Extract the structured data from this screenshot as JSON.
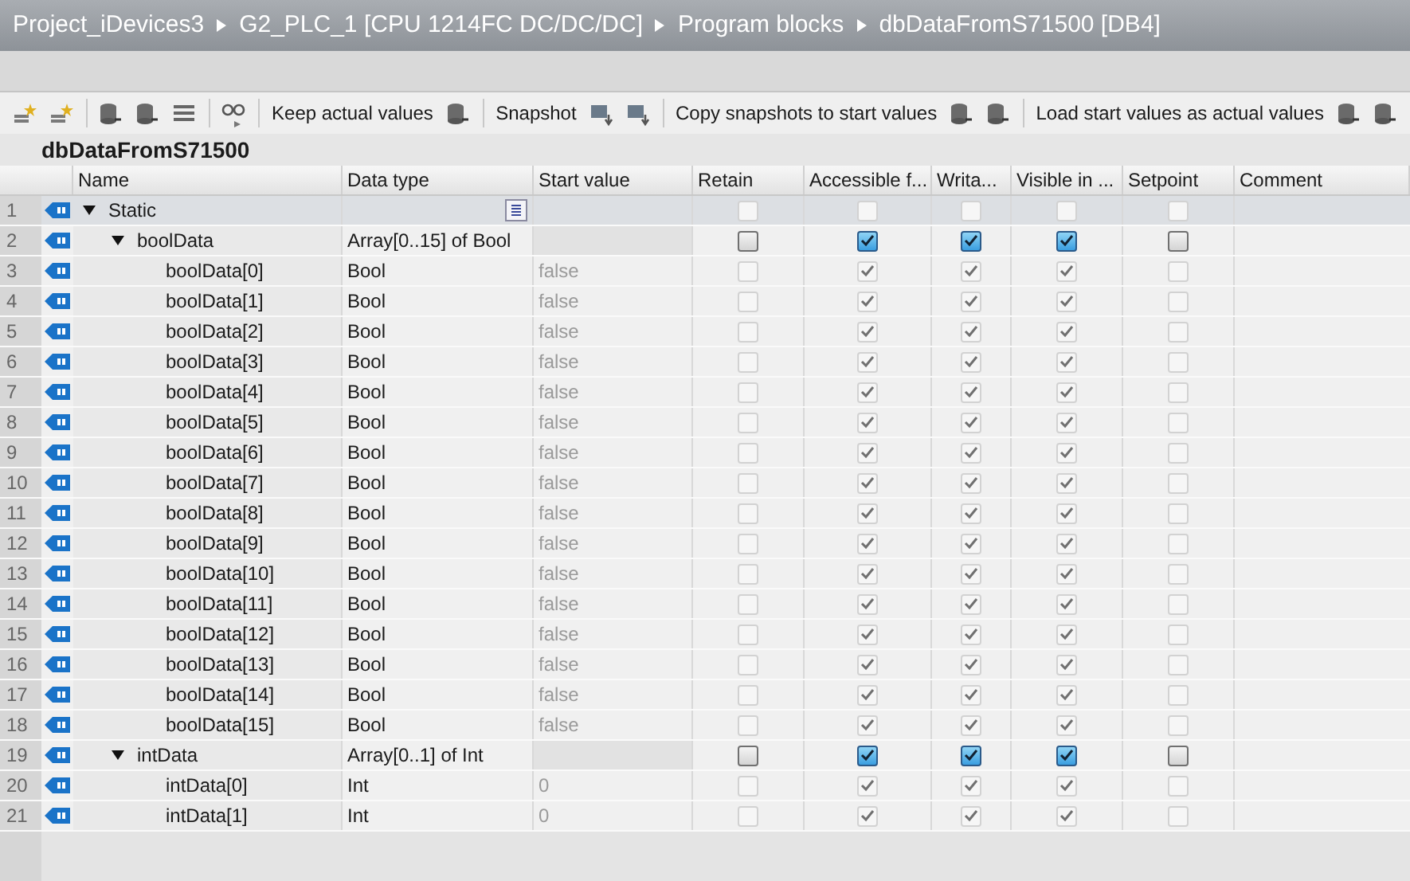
{
  "breadcrumb": [
    "Project_iDevices3",
    "G2_PLC_1 [CPU 1214FC DC/DC/DC]",
    "Program blocks",
    "dbDataFromS71500 [DB4]"
  ],
  "toolbar": [
    "Keep actual values",
    "Snapshot",
    "Copy snapshots to start values",
    "Load start values as actual values"
  ],
  "block_title": "dbDataFromS71500",
  "columns": [
    "Name",
    "Data type",
    "Start value",
    "Retain",
    "Accessible f...",
    "Writa...",
    "Visible in ...",
    "Setpoint",
    "Comment"
  ],
  "rows": [
    {
      "number": "1",
      "name": "Static",
      "expanded": true,
      "flags": [
        {
          "checked": false,
          "disabled": true
        },
        {
          "checked": false,
          "disabled": true
        },
        {
          "checked": false,
          "disabled": true
        },
        {
          "checked": false,
          "disabled": true
        },
        {
          "checked": false,
          "disabled": true
        }
      ],
      "children": [
        {
          "number": "2",
          "name": "boolData",
          "data_type": "Array[0..15] of Bool",
          "expanded": true,
          "flags": [
            {
              "checked": false,
              "disabled": false
            },
            {
              "checked": true,
              "disabled": false
            },
            {
              "checked": true,
              "disabled": false
            },
            {
              "checked": true,
              "disabled": false
            },
            {
              "checked": false,
              "disabled": false
            }
          ],
          "children": [
            {
              "number": "3",
              "name": "boolData[0]",
              "data_type": "Bool",
              "start_value": "false",
              "flags": [
                {
                  "checked": false,
                  "disabled": true
                },
                {
                  "checked": true,
                  "disabled": true
                },
                {
                  "checked": true,
                  "disabled": true
                },
                {
                  "checked": true,
                  "disabled": true
                },
                {
                  "checked": false,
                  "disabled": true
                }
              ]
            },
            {
              "number": "4",
              "name": "boolData[1]",
              "data_type": "Bool",
              "start_value": "false",
              "flags": [
                {
                  "checked": false,
                  "disabled": true
                },
                {
                  "checked": true,
                  "disabled": true
                },
                {
                  "checked": true,
                  "disabled": true
                },
                {
                  "checked": true,
                  "disabled": true
                },
                {
                  "checked": false,
                  "disabled": true
                }
              ]
            },
            {
              "number": "5",
              "name": "boolData[2]",
              "data_type": "Bool",
              "start_value": "false",
              "flags": [
                {
                  "checked": false,
                  "disabled": true
                },
                {
                  "checked": true,
                  "disabled": true
                },
                {
                  "checked": true,
                  "disabled": true
                },
                {
                  "checked": true,
                  "disabled": true
                },
                {
                  "checked": false,
                  "disabled": true
                }
              ]
            },
            {
              "number": "6",
              "name": "boolData[3]",
              "data_type": "Bool",
              "start_value": "false",
              "flags": [
                {
                  "checked": false,
                  "disabled": true
                },
                {
                  "checked": true,
                  "disabled": true
                },
                {
                  "checked": true,
                  "disabled": true
                },
                {
                  "checked": true,
                  "disabled": true
                },
                {
                  "checked": false,
                  "disabled": true
                }
              ]
            },
            {
              "number": "7",
              "name": "boolData[4]",
              "data_type": "Bool",
              "start_value": "false",
              "flags": [
                {
                  "checked": false,
                  "disabled": true
                },
                {
                  "checked": true,
                  "disabled": true
                },
                {
                  "checked": true,
                  "disabled": true
                },
                {
                  "checked": true,
                  "disabled": true
                },
                {
                  "checked": false,
                  "disabled": true
                }
              ]
            },
            {
              "number": "8",
              "name": "boolData[5]",
              "data_type": "Bool",
              "start_value": "false",
              "flags": [
                {
                  "checked": false,
                  "disabled": true
                },
                {
                  "checked": true,
                  "disabled": true
                },
                {
                  "checked": true,
                  "disabled": true
                },
                {
                  "checked": true,
                  "disabled": true
                },
                {
                  "checked": false,
                  "disabled": true
                }
              ]
            },
            {
              "number": "9",
              "name": "boolData[6]",
              "data_type": "Bool",
              "start_value": "false",
              "flags": [
                {
                  "checked": false,
                  "disabled": true
                },
                {
                  "checked": true,
                  "disabled": true
                },
                {
                  "checked": true,
                  "disabled": true
                },
                {
                  "checked": true,
                  "disabled": true
                },
                {
                  "checked": false,
                  "disabled": true
                }
              ]
            },
            {
              "number": "10",
              "name": "boolData[7]",
              "data_type": "Bool",
              "start_value": "false",
              "flags": [
                {
                  "checked": false,
                  "disabled": true
                },
                {
                  "checked": true,
                  "disabled": true
                },
                {
                  "checked": true,
                  "disabled": true
                },
                {
                  "checked": true,
                  "disabled": true
                },
                {
                  "checked": false,
                  "disabled": true
                }
              ]
            },
            {
              "number": "11",
              "name": "boolData[8]",
              "data_type": "Bool",
              "start_value": "false",
              "flags": [
                {
                  "checked": false,
                  "disabled": true
                },
                {
                  "checked": true,
                  "disabled": true
                },
                {
                  "checked": true,
                  "disabled": true
                },
                {
                  "checked": true,
                  "disabled": true
                },
                {
                  "checked": false,
                  "disabled": true
                }
              ]
            },
            {
              "number": "12",
              "name": "boolData[9]",
              "data_type": "Bool",
              "start_value": "false",
              "flags": [
                {
                  "checked": false,
                  "disabled": true
                },
                {
                  "checked": true,
                  "disabled": true
                },
                {
                  "checked": true,
                  "disabled": true
                },
                {
                  "checked": true,
                  "disabled": true
                },
                {
                  "checked": false,
                  "disabled": true
                }
              ]
            },
            {
              "number": "13",
              "name": "boolData[10]",
              "data_type": "Bool",
              "start_value": "false",
              "flags": [
                {
                  "checked": false,
                  "disabled": true
                },
                {
                  "checked": true,
                  "disabled": true
                },
                {
                  "checked": true,
                  "disabled": true
                },
                {
                  "checked": true,
                  "disabled": true
                },
                {
                  "checked": false,
                  "disabled": true
                }
              ]
            },
            {
              "number": "14",
              "name": "boolData[11]",
              "data_type": "Bool",
              "start_value": "false",
              "flags": [
                {
                  "checked": false,
                  "disabled": true
                },
                {
                  "checked": true,
                  "disabled": true
                },
                {
                  "checked": true,
                  "disabled": true
                },
                {
                  "checked": true,
                  "disabled": true
                },
                {
                  "checked": false,
                  "disabled": true
                }
              ]
            },
            {
              "number": "15",
              "name": "boolData[12]",
              "data_type": "Bool",
              "start_value": "false",
              "flags": [
                {
                  "checked": false,
                  "disabled": true
                },
                {
                  "checked": true,
                  "disabled": true
                },
                {
                  "checked": true,
                  "disabled": true
                },
                {
                  "checked": true,
                  "disabled": true
                },
                {
                  "checked": false,
                  "disabled": true
                }
              ]
            },
            {
              "number": "16",
              "name": "boolData[13]",
              "data_type": "Bool",
              "start_value": "false",
              "flags": [
                {
                  "checked": false,
                  "disabled": true
                },
                {
                  "checked": true,
                  "disabled": true
                },
                {
                  "checked": true,
                  "disabled": true
                },
                {
                  "checked": true,
                  "disabled": true
                },
                {
                  "checked": false,
                  "disabled": true
                }
              ]
            },
            {
              "number": "17",
              "name": "boolData[14]",
              "data_type": "Bool",
              "start_value": "false",
              "flags": [
                {
                  "checked": false,
                  "disabled": true
                },
                {
                  "checked": true,
                  "disabled": true
                },
                {
                  "checked": true,
                  "disabled": true
                },
                {
                  "checked": true,
                  "disabled": true
                },
                {
                  "checked": false,
                  "disabled": true
                }
              ]
            },
            {
              "number": "18",
              "name": "boolData[15]",
              "data_type": "Bool",
              "start_value": "false",
              "flags": [
                {
                  "checked": false,
                  "disabled": true
                },
                {
                  "checked": true,
                  "disabled": true
                },
                {
                  "checked": true,
                  "disabled": true
                },
                {
                  "checked": true,
                  "disabled": true
                },
                {
                  "checked": false,
                  "disabled": true
                }
              ]
            }
          ]
        },
        {
          "number": "19",
          "name": "intData",
          "data_type": "Array[0..1] of Int",
          "expanded": true,
          "flags": [
            {
              "checked": false,
              "disabled": false
            },
            {
              "checked": true,
              "disabled": false
            },
            {
              "checked": true,
              "disabled": false
            },
            {
              "checked": true,
              "disabled": false
            },
            {
              "checked": false,
              "disabled": false
            }
          ],
          "children": [
            {
              "number": "20",
              "name": "intData[0]",
              "data_type": "Int",
              "start_value": "0",
              "flags": [
                {
                  "checked": false,
                  "disabled": true
                },
                {
                  "checked": true,
                  "disabled": true
                },
                {
                  "checked": true,
                  "disabled": true
                },
                {
                  "checked": true,
                  "disabled": true
                },
                {
                  "checked": false,
                  "disabled": true
                }
              ]
            },
            {
              "number": "21",
              "name": "intData[1]",
              "data_type": "Int",
              "start_value": "0",
              "flags": [
                {
                  "checked": false,
                  "disabled": true
                },
                {
                  "checked": true,
                  "disabled": true
                },
                {
                  "checked": true,
                  "disabled": true
                },
                {
                  "checked": true,
                  "disabled": true
                },
                {
                  "checked": false,
                  "disabled": true
                }
              ]
            }
          ]
        }
      ]
    }
  ]
}
